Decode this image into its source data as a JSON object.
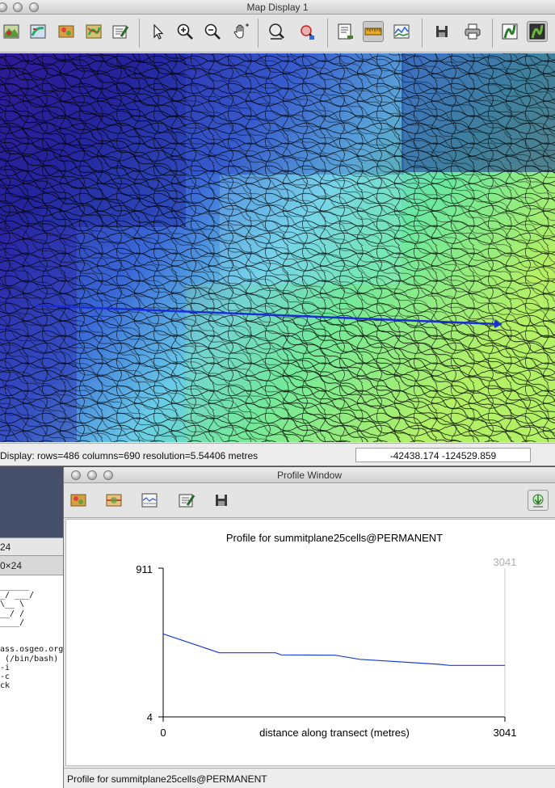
{
  "map_window": {
    "title": "Map Display 1",
    "status_text": "Display: rows=486  columns=690  resolution=5.54406 metres",
    "coordinates": "-42438.174   -124529.859",
    "toolbar_tools": [
      "display-map",
      "overlay",
      "add-raster",
      "add-vector",
      "layer-manager",
      "pointer",
      "zoom-in",
      "zoom-out",
      "pan",
      "zoom-region",
      "query",
      "analyze",
      "measure",
      "profile",
      "save",
      "print",
      "map-icon",
      "map-2"
    ]
  },
  "terminal_window": {
    "tab1": "24",
    "tab2": "0×24",
    "lines": [
      "______",
      "_/ ___/",
      "\\__ \\",
      "__/ /",
      "____/",
      "",
      "",
      "ass.osgeo.org/",
      " (/bin/bash)",
      "-i",
      "-c",
      "ck"
    ]
  },
  "profile_window": {
    "title": "Profile Window",
    "status_text": "Profile for summitplane25cells@PERMANENT"
  },
  "chart_data": {
    "type": "line",
    "title": "Profile for summitplane25cells@PERMANENT",
    "xlabel": "distance along transect (metres)",
    "ylabel": "",
    "xlim": [
      0,
      3041
    ],
    "ylim": [
      4,
      911
    ],
    "x_ticks": [
      "0",
      "3041"
    ],
    "y_ticks": [
      "4",
      "911"
    ],
    "corner_label": "3041",
    "series": [
      {
        "color": "#1a3fd0",
        "x": [
          0,
          500,
          1000,
          1050,
          1530,
          1750,
          2450,
          2550,
          3041
        ],
        "y": [
          510,
          395,
          395,
          382,
          380,
          355,
          325,
          318,
          318
        ]
      }
    ]
  },
  "colors": {
    "transect_line": "#1a2fd8",
    "profile_line": "#1a3fd0"
  }
}
